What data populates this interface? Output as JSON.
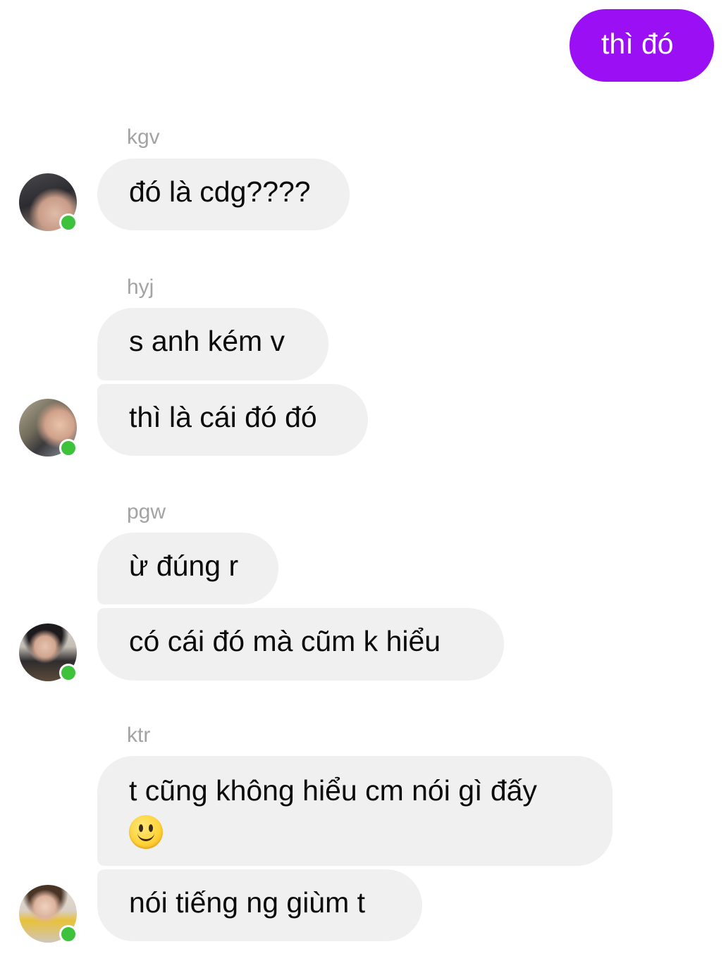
{
  "chat": {
    "outgoing": [
      {
        "text": "thì đó"
      }
    ],
    "groups": [
      {
        "sender": "kgv",
        "avatar": "avatar-photo",
        "messages": [
          {
            "text": "đó là cdg????"
          }
        ]
      },
      {
        "sender": "hyj",
        "avatar": "avatar-photo",
        "messages": [
          {
            "text": "s anh kém v"
          },
          {
            "text": "thì là cái đó đó"
          }
        ]
      },
      {
        "sender": "pgw",
        "avatar": "avatar-photo",
        "messages": [
          {
            "text": "ừ đúng r"
          },
          {
            "text": "có cái đó mà cũm k hiểu"
          }
        ]
      },
      {
        "sender": "ktr",
        "avatar": "avatar-photo",
        "messages": [
          {
            "text": "t cũng không hiểu cm nói gì đấy",
            "emoji": "slightly-smiling-face-emoji"
          },
          {
            "text": "nói tiếng ng giùm t"
          }
        ]
      }
    ]
  },
  "colors": {
    "outgoing_bubble": "#9b0ff5",
    "incoming_bubble": "#f0f0f0",
    "sender_name": "#a3a3a3",
    "online_dot": "#3ec23c"
  }
}
